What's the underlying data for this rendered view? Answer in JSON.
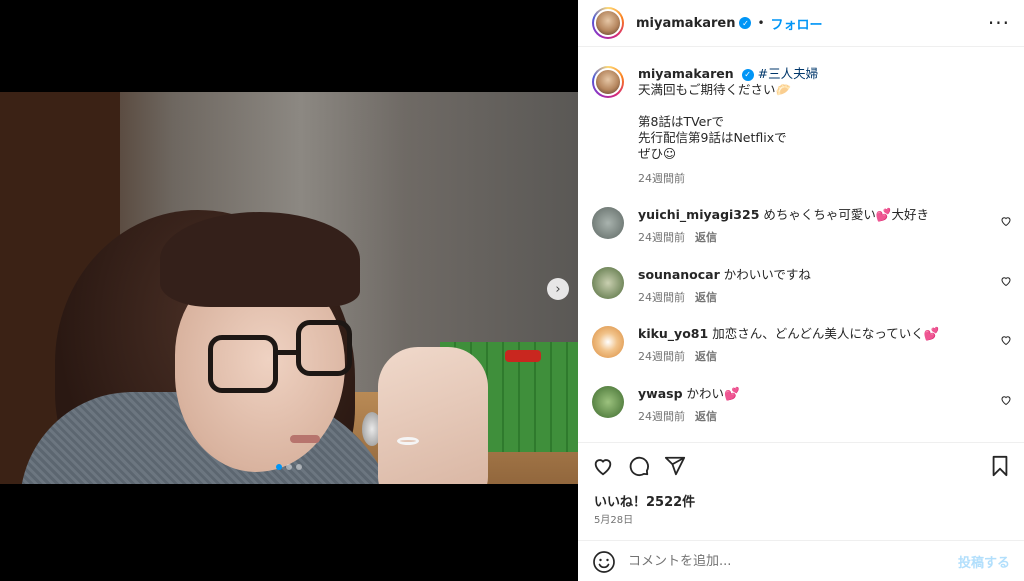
{
  "post": {
    "username": "miyamakaren",
    "follow_label": "フォロー",
    "separator": "•",
    "more_label": "···",
    "media": {
      "dots_total": 3,
      "dots_active": 1,
      "next_label": "›"
    }
  },
  "caption": {
    "username": "miyamakaren",
    "hashtag": "#三人夫婦",
    "lines": [
      "天満回もご期待ください🥟",
      "",
      "第8話はTVerで",
      "先行配信第9話はNetflixで",
      "ぜひ☺"
    ],
    "time": "24週間前"
  },
  "comments": [
    {
      "user": "yuichi_miyagi325",
      "text": "めちゃくちゃ可愛い💕大好き",
      "time": "24週間前",
      "reply": "返信",
      "avatar_color": "#7f8a86"
    },
    {
      "user": "sounanocar",
      "text": "かわいいですね",
      "time": "24週間前",
      "reply": "返信",
      "avatar_color": "#5d7a46"
    },
    {
      "user": "kiku_yo81",
      "text": "加恋さん、どんどん美人になっていく💕",
      "time": "24週間前",
      "reply": "返信",
      "avatar_color": "#e1a35a"
    },
    {
      "user": "ywasp",
      "text": "かわい💕",
      "time": "24週間前",
      "reply": "返信",
      "avatar_color": "#4e7a3a"
    }
  ],
  "actions": {
    "likes": "いいね！2522件",
    "date": "5月28日"
  },
  "add_comment": {
    "placeholder": "コメントを追加...",
    "post_label": "投稿する"
  },
  "colors": {
    "accent": "#0095f6",
    "verified": "#0095f6",
    "post_disabled": "#b2dffc"
  },
  "icons": [
    "verified-icon",
    "more-icon",
    "heart-icon",
    "comment-icon",
    "share-icon",
    "bookmark-icon",
    "emoji-icon",
    "chevron-right-icon"
  ]
}
